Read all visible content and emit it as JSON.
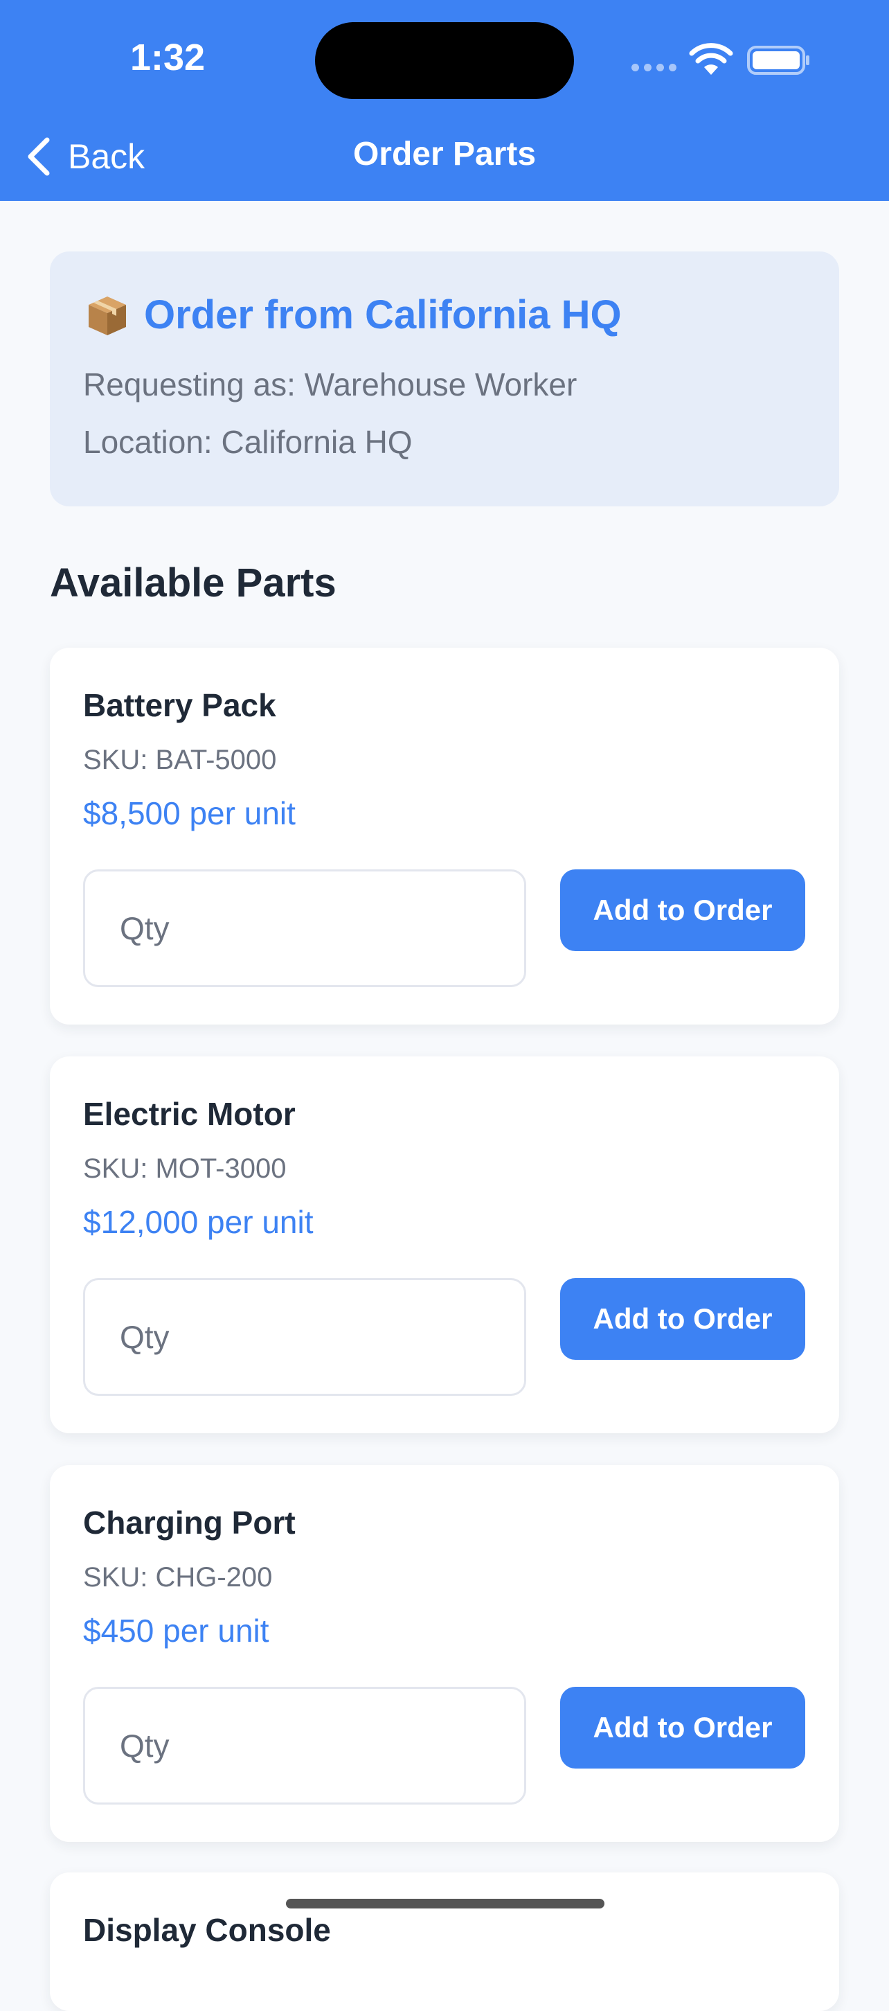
{
  "status_bar": {
    "time": "1:32"
  },
  "nav": {
    "back_label": "Back",
    "title": "Order Parts"
  },
  "info": {
    "title": "Order from California HQ",
    "requesting": "Requesting as: Warehouse Worker",
    "location": "Location: California HQ"
  },
  "section_title": "Available Parts",
  "parts": [
    {
      "name": "Battery Pack",
      "sku": "SKU: BAT-5000",
      "price": "$8,500 per unit",
      "qty_placeholder": "Qty",
      "button": "Add to Order"
    },
    {
      "name": "Electric Motor",
      "sku": "SKU: MOT-3000",
      "price": "$12,000 per unit",
      "qty_placeholder": "Qty",
      "button": "Add to Order"
    },
    {
      "name": "Charging Port",
      "sku": "SKU: CHG-200",
      "price": "$450 per unit",
      "qty_placeholder": "Qty",
      "button": "Add to Order"
    },
    {
      "name": "Display Console"
    }
  ],
  "icons": {
    "back": "chevron-left-icon",
    "info": "package-icon",
    "wifi": "wifi-icon",
    "battery": "battery-icon"
  },
  "colors": {
    "accent": "#3d82f3",
    "background": "#f7f9fc",
    "info_bg": "#e6edf9"
  }
}
